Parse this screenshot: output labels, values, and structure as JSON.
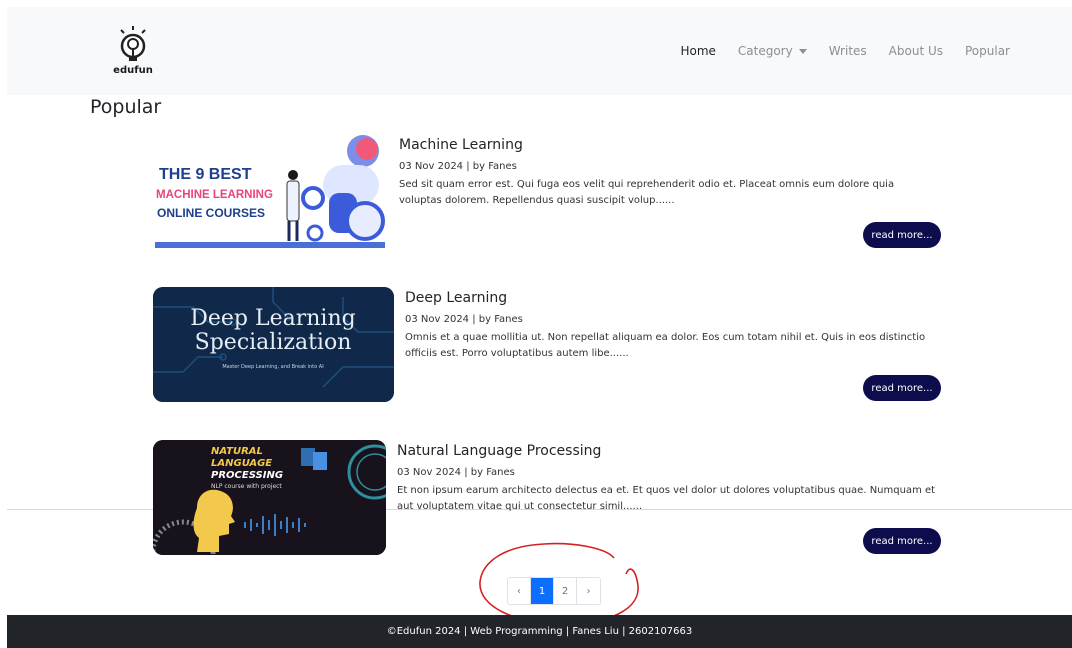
{
  "nav": {
    "brand": "edufun",
    "links": [
      {
        "label": "Home",
        "active": true
      },
      {
        "label": "Category",
        "dropdown": true
      },
      {
        "label": "Writes"
      },
      {
        "label": "About Us"
      },
      {
        "label": "Popular"
      }
    ]
  },
  "page_title": "Popular",
  "posts": [
    {
      "title": "Machine Learning",
      "meta": "03 Nov 2024 | by Fanes",
      "excerpt": "Sed sit quam error est. Qui fuga eos velit qui reprehenderit odio et. Placeat omnis eum dolore quia voluptas dolorem. Repellendus quasi suscipit volup......",
      "read_more": "read more...",
      "thumb": {
        "line1": "THE 9 BEST",
        "line2": "MACHINE LEARNING",
        "line3": "ONLINE COURSES"
      }
    },
    {
      "title": "Deep Learning",
      "meta": "03 Nov 2024 | by Fanes",
      "excerpt": "Omnis et a quae mollitia ut. Non repellat aliquam ea dolor. Eos cum totam nihil et. Quis in eos distinctio officiis est. Porro voluptatibus autem libe......",
      "read_more": "read more...",
      "thumb": {
        "line1": "Deep Learning",
        "line2": "Specialization",
        "line3": "Master Deep Learning, and Break into AI"
      }
    },
    {
      "title": "Natural Language Processing",
      "meta": "03 Nov 2024 | by Fanes",
      "excerpt": "Et non ipsum earum architecto delectus ea et. Et quos vel dolor ut dolores voluptatibus quae. Numquam et aut voluptatem vitae qui ut consectetur simil......",
      "read_more": "read more...",
      "thumb": {
        "line1": "NATURAL",
        "line2": "LANGUAGE",
        "line3": "PROCESSING",
        "line4": "NLP course with project"
      }
    }
  ],
  "pagination": {
    "prev": "‹",
    "pages": [
      "1",
      "2"
    ],
    "current": "1",
    "next": "›"
  },
  "footer": "©Edufun 2024 | Web Programming | Fanes Liu | 2602107663",
  "colors": {
    "button": "#0d0d4e",
    "page_active": "#0d6efd",
    "footer_bg": "#212529",
    "annotation": "#d62020"
  }
}
